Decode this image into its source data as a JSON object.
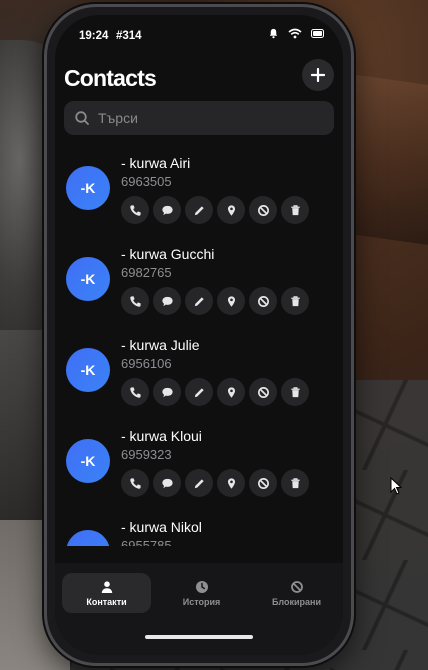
{
  "status_bar": {
    "time": "19:24",
    "id": "#314"
  },
  "header": {
    "title": "Contacts",
    "add_icon": "plus-icon"
  },
  "search": {
    "placeholder": "Търси",
    "value": ""
  },
  "contacts": [
    {
      "initials": "-K",
      "name": "- kurwa Airi",
      "phone": "6963505"
    },
    {
      "initials": "-K",
      "name": "- kurwa Gucchi",
      "phone": "6982765"
    },
    {
      "initials": "-K",
      "name": "- kurwa Julie",
      "phone": "6956106"
    },
    {
      "initials": "-K",
      "name": "- kurwa Kloui",
      "phone": "6959323"
    },
    {
      "initials": "-K",
      "name": "- kurwa Nikol",
      "phone": "6955785"
    }
  ],
  "actions": [
    "phone-icon",
    "message-icon",
    "edit-icon",
    "location-icon",
    "block-icon",
    "trash-icon"
  ],
  "tabs": [
    {
      "label": "Контакти",
      "icon": "person-icon",
      "active": true
    },
    {
      "label": "История",
      "icon": "clock-icon",
      "active": false
    },
    {
      "label": "Блокирани",
      "icon": "block-icon",
      "active": false
    }
  ],
  "colors": {
    "avatar": "#3b82f6",
    "background": "#0f0f10",
    "surface": "#262628"
  }
}
